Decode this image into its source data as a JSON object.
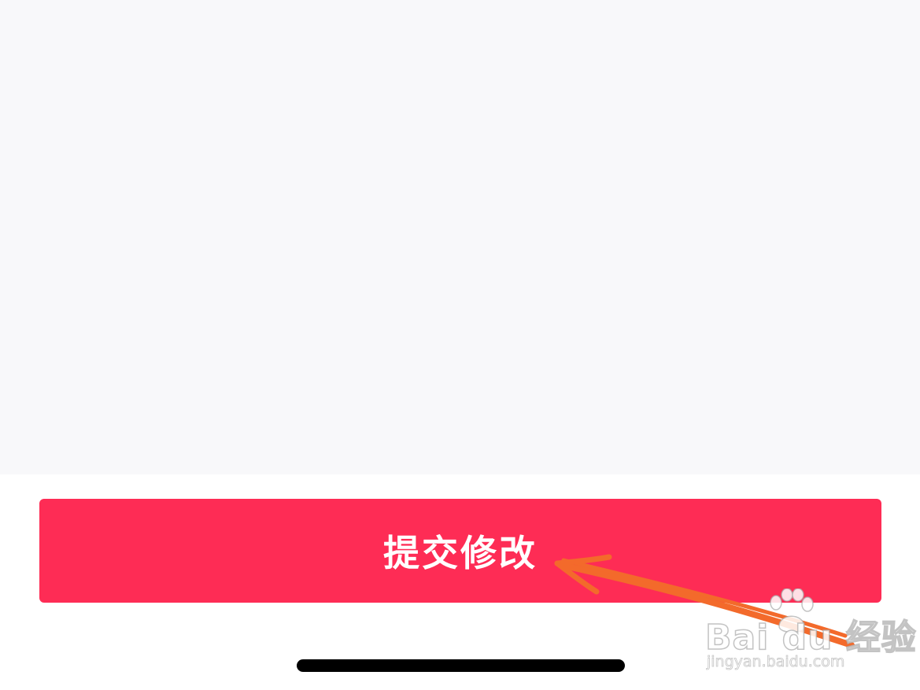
{
  "submit": {
    "label": "提交修改",
    "background": "#fe2c55",
    "text_color": "#ffffff"
  },
  "annotation": {
    "arrow_color": "#f36a2b",
    "arrow_icon": "hand-drawn-arrow-icon"
  },
  "watermark": {
    "logo_text": "Bai du 经验",
    "url_text": "jingyan.baidu.com",
    "logo_icon": "paw-icon"
  },
  "colors": {
    "content_background": "#f8f8fa",
    "bottom_background": "#ffffff",
    "home_indicator": "#000000"
  }
}
